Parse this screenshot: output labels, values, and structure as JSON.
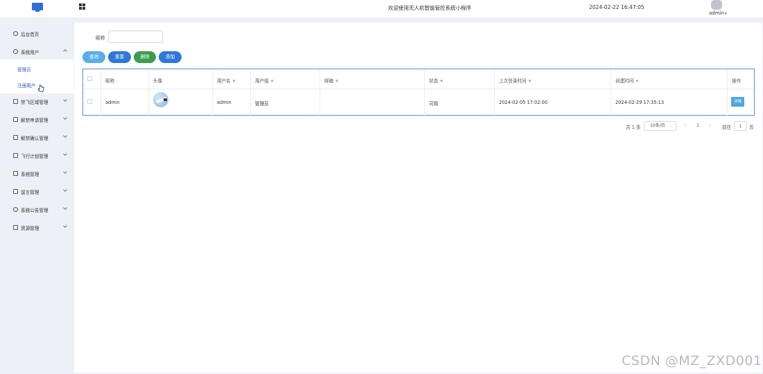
{
  "header": {
    "title": "欢迎使用无人机智能管控系统小程序",
    "datetime": "2024-02-22 16:47:05",
    "user": "admin"
  },
  "sidebar": {
    "items": [
      {
        "label": "后台首页",
        "icon": "clock-icon"
      },
      {
        "label": "系统用户",
        "icon": "user-icon",
        "expanded": true
      },
      {
        "label": "禁飞区域管理",
        "icon": "region-icon"
      },
      {
        "label": "解禁申请管理",
        "icon": "apply-icon"
      },
      {
        "label": "解禁确认管理",
        "icon": "confirm-icon"
      },
      {
        "label": "飞行计划管理",
        "icon": "plan-icon"
      },
      {
        "label": "系统管理",
        "icon": "folder-icon"
      },
      {
        "label": "留言管理",
        "icon": "message-icon"
      },
      {
        "label": "系统公告管理",
        "icon": "search-icon"
      },
      {
        "label": "资源管理",
        "icon": "resource-icon"
      }
    ],
    "submenu": [
      "管理员",
      "注册用户"
    ]
  },
  "search": {
    "label": "昵称",
    "value": ""
  },
  "toolbar": {
    "query": "查询",
    "reset": "重置",
    "delete": "删除",
    "add": "添加"
  },
  "table": {
    "columns": [
      "昵称",
      "头像",
      "用户名",
      "用户组",
      "邮箱",
      "状态",
      "上次登录时间",
      "创建时间",
      "操作"
    ],
    "rows": [
      {
        "nickname": "admin",
        "username": "admin",
        "group": "管理员",
        "email": "",
        "status": "可用",
        "last_login": "2024-02-05 17:02:00",
        "created": "2024-02-29 17:35:13",
        "action": "详情"
      }
    ]
  },
  "pagination": {
    "total": "共 1 条",
    "page_size": "10条/页",
    "prev": "‹",
    "current": "1",
    "next": "›",
    "goto": "前往",
    "goto_value": "1",
    "page_suffix": "页"
  },
  "watermark": "CSDN @MZ_ZXD001",
  "colors": {
    "primary": "#2d78d8",
    "query": "#5aaee8",
    "delete": "#3a9d4e",
    "sidebar_bg": "#edf1f7"
  }
}
